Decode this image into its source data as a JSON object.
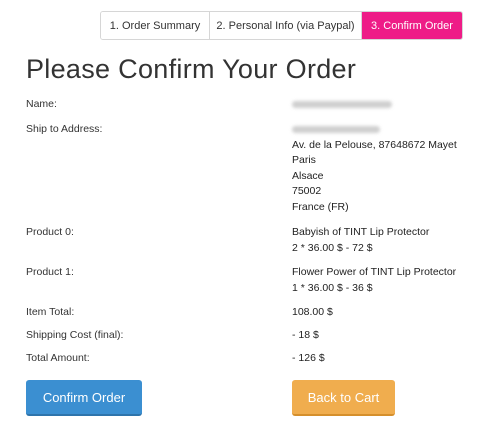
{
  "steps": [
    {
      "label": "1. Order Summary"
    },
    {
      "label": "2. Personal Info (via Paypal)"
    },
    {
      "label": "3. Confirm Order"
    }
  ],
  "title": "Please Confirm Your Order",
  "details": {
    "name": {
      "label": "Name:"
    },
    "ship": {
      "label": "Ship to Address:",
      "lines": [
        "Av. de la Pelouse, 87648672 Mayet",
        "Paris",
        "Alsace",
        "75002",
        "France (FR)"
      ]
    },
    "product0": {
      "label": "Product 0:",
      "name": "Babyish of TINT Lip Protector",
      "price": "2 * 36.00 $ - 72 $"
    },
    "product1": {
      "label": "Product 1:",
      "name": "Flower Power of TINT Lip Protector",
      "price": "1 * 36.00 $ - 36 $"
    },
    "item_total": {
      "label": "Item Total:",
      "value": "108.00 $"
    },
    "shipping": {
      "label": "Shipping Cost (final):",
      "value": "- 18 $"
    },
    "total": {
      "label": "Total Amount:",
      "value": "- 126 $"
    }
  },
  "buttons": {
    "confirm": "Confirm Order",
    "back": "Back to Cart"
  },
  "colors": {
    "active_step": "#ee1c87",
    "confirm_button": "#3b8fd1",
    "back_button": "#f0ad4e"
  }
}
